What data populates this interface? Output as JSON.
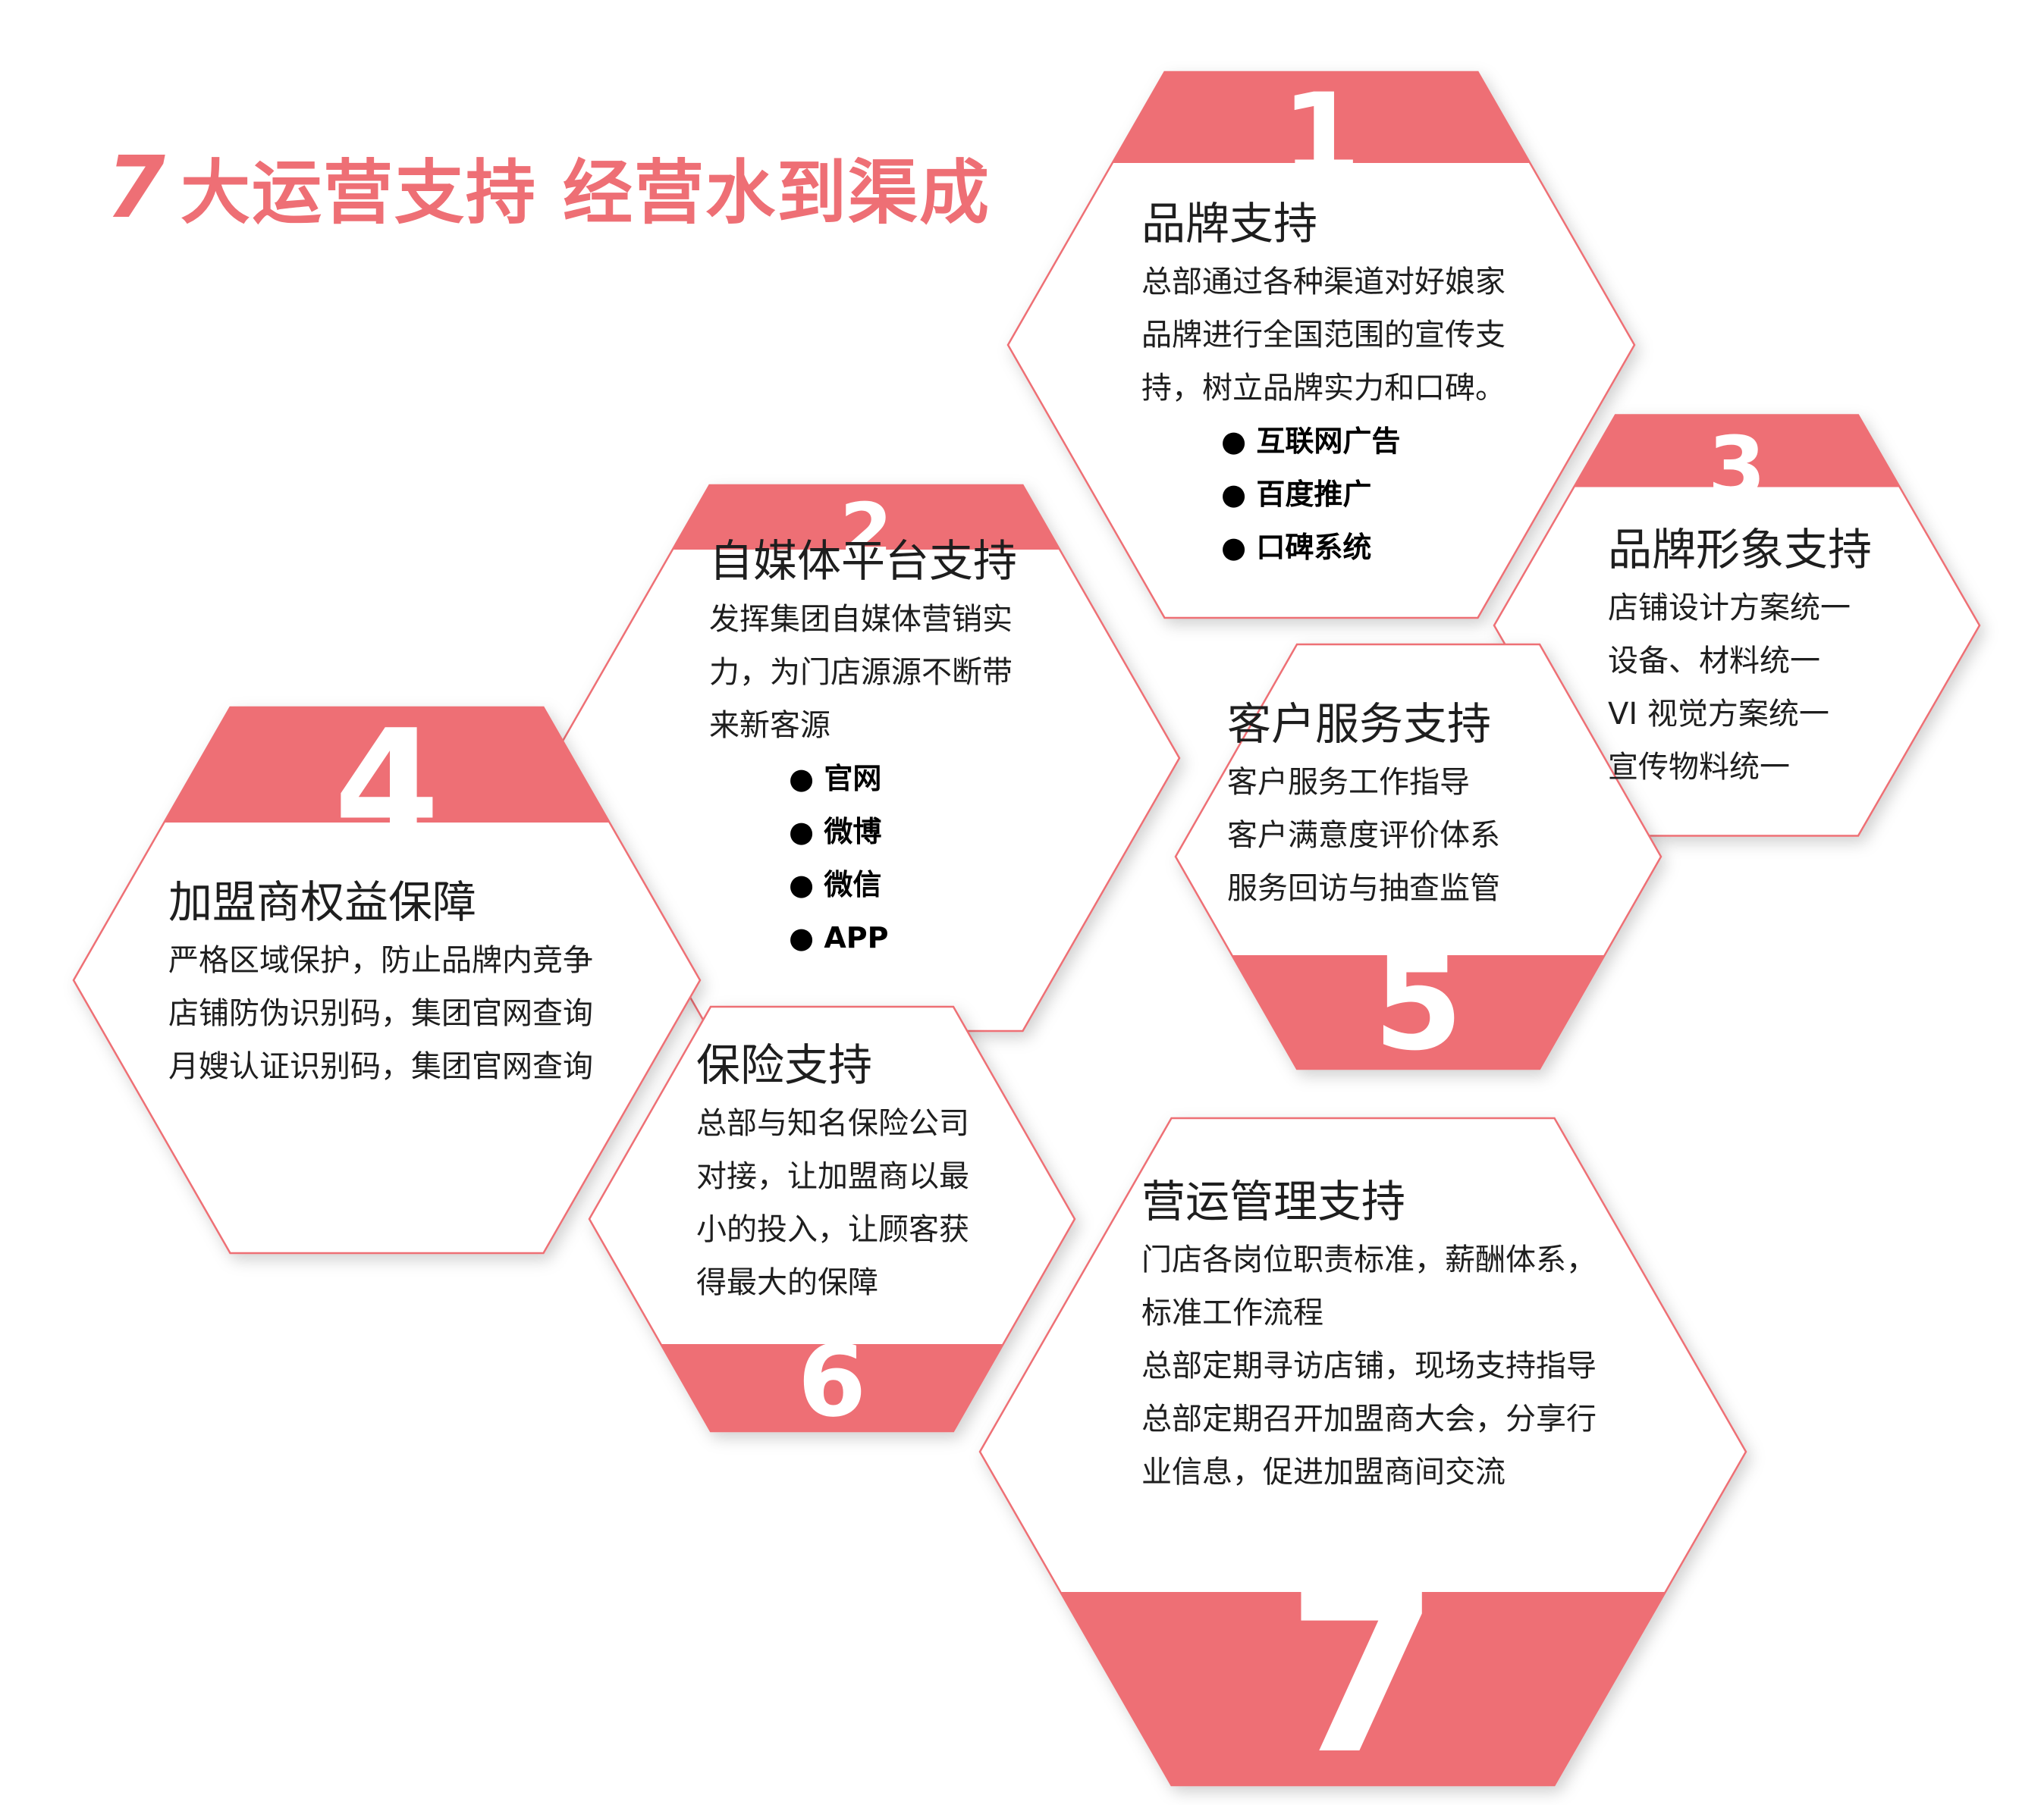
{
  "title": {
    "number": "7",
    "text": "大运营支持 经营水到渠成"
  },
  "colors": {
    "accent": "#ee6f75",
    "outline": "#ee6f75",
    "text": "#1e1e1e"
  },
  "cards": [
    {
      "number": "1",
      "title": "品牌支持",
      "lines": [
        "总部通过各种渠道对好娘家",
        "品牌进行全国范围的宣传支",
        "持，树立品牌实力和口碑。"
      ],
      "bullets": [
        "互联网广告",
        "百度推广",
        "口碑系统"
      ]
    },
    {
      "number": "2",
      "title": "自媒体平台支持",
      "lines": [
        "发挥集团自媒体营销实",
        "力，为门店源源不断带",
        "来新客源"
      ],
      "bullets": [
        "官网",
        "微博",
        "微信",
        "APP"
      ]
    },
    {
      "number": "3",
      "title": "品牌形象支持",
      "lines": [
        "店铺设计方案统一",
        "设备、材料统一",
        "VI 视觉方案统一",
        "宣传物料统一"
      ],
      "bullets": []
    },
    {
      "number": "4",
      "title": "加盟商权益保障",
      "lines": [
        "严格区域保护，防止品牌内竞争",
        "店铺防伪识别码，集团官网查询",
        "月嫂认证识别码，集团官网查询"
      ],
      "bullets": []
    },
    {
      "number": "5",
      "title": "客户服务支持",
      "lines": [
        "客户服务工作指导",
        "客户满意度评价体系",
        "服务回访与抽查监管"
      ],
      "bullets": []
    },
    {
      "number": "6",
      "title": "保险支持",
      "lines": [
        "总部与知名保险公司",
        "对接，让加盟商以最",
        "小的投入，让顾客获",
        "得最大的保障"
      ],
      "bullets": []
    },
    {
      "number": "7",
      "title": "营运管理支持",
      "lines": [
        "门店各岗位职责标准，薪酬体系，",
        "标准工作流程",
        "总部定期寻访店铺，现场支持指导",
        "总部定期召开加盟商大会，分享行",
        "业信息，促进加盟商间交流"
      ],
      "bullets": []
    }
  ]
}
